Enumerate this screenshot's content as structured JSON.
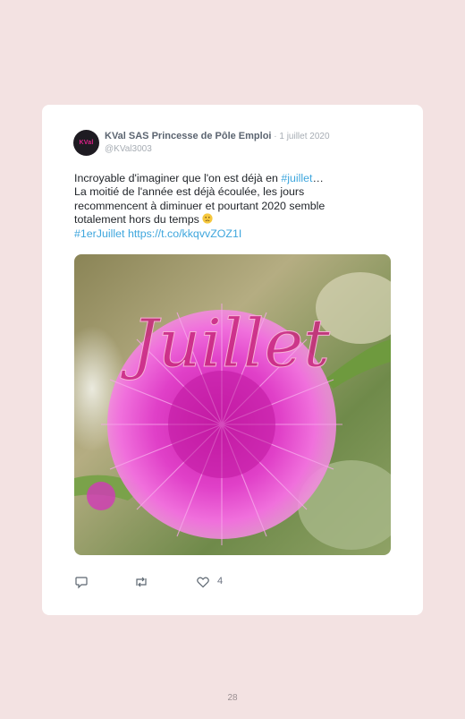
{
  "tweet": {
    "avatar_text": "KVal",
    "author": "KVal SAS Princesse de Pôle Emploi",
    "separator": " · ",
    "date": "1 juillet 2020",
    "handle": "@KVal3003",
    "text_part1": "Incroyable d'imaginer que l'on est déjà en ",
    "hashtag_inline": "#juillet",
    "text_part2": "…",
    "text_line2": "La moitié de l'année est déjà écoulée, les jours recommencent à diminuer et pourtant 2020 semble totalement hors du temps ",
    "hashtag_end": "#1erJuillet",
    "link": "https://t.co/kkqvvZOZ1I",
    "image_overlay_text": "Juillet",
    "like_count": "4"
  },
  "icons": [
    "reply-icon",
    "retweet-icon",
    "like-icon",
    "slightly-frowning-emoji"
  ],
  "colors": {
    "page_background": "#f3e2e2",
    "link": "#3ea6dd",
    "author": "#5b6470",
    "flower": "#e040c8"
  },
  "page": {
    "number": "28"
  }
}
